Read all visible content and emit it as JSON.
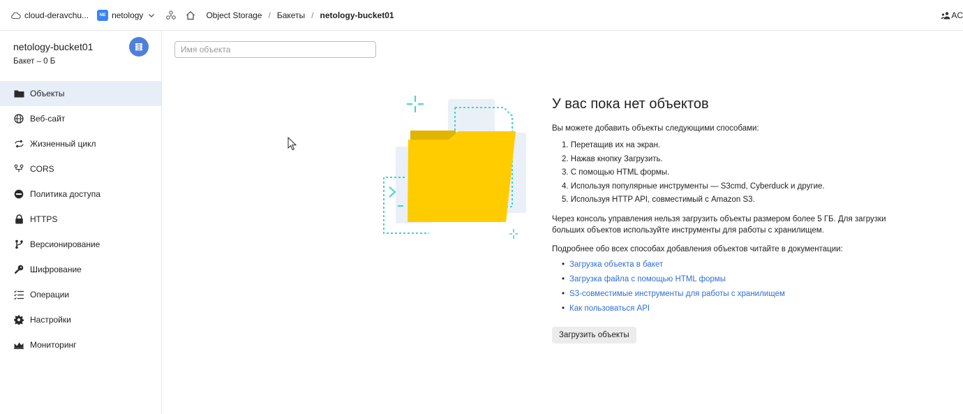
{
  "topbar": {
    "cloud_name": "cloud-deravchu...",
    "folder_badge": "NE",
    "folder_name": "netology",
    "service": "Object Storage",
    "crumb_buckets": "Бакеты",
    "crumb_current": "netology-bucket01",
    "user_initials": "AC",
    "separator": "/"
  },
  "sidebar": {
    "bucket_name": "netology-bucket01",
    "bucket_sub": "Бакет – 0 Б",
    "items": [
      {
        "label": "Объекты",
        "icon": "folder-icon"
      },
      {
        "label": "Веб-сайт",
        "icon": "globe-icon"
      },
      {
        "label": "Жизненный цикл",
        "icon": "lifecycle-icon"
      },
      {
        "label": "CORS",
        "icon": "cors-icon"
      },
      {
        "label": "Политика доступа",
        "icon": "access-policy-icon"
      },
      {
        "label": "HTTPS",
        "icon": "lock-icon"
      },
      {
        "label": "Версионирование",
        "icon": "branch-icon"
      },
      {
        "label": "Шифрование",
        "icon": "key-icon"
      },
      {
        "label": "Операции",
        "icon": "operations-list-icon"
      },
      {
        "label": "Настройки",
        "icon": "gear-icon"
      },
      {
        "label": "Мониторинг",
        "icon": "chart-icon"
      }
    ]
  },
  "main": {
    "search_placeholder": "Имя объекта",
    "title": "У вас пока нет объектов",
    "intro": "Вы можете добавить объекты следующими способами:",
    "steps": [
      "1. Перетащив их на экран.",
      "2. Нажав кнопку Загрузить.",
      "3. С помощью HTML формы.",
      "4. Используя популярные инструменты — S3cmd, Cyberduck и другие.",
      "5. Используя HTTP API, совместимый с Amazon S3."
    ],
    "limits": "Через консоль управления нельзя загрузить объекты размером более 5 ГБ. Для загрузки больших объектов используйте инструменты для работы с хранилищем.",
    "docs_intro": "Подробнее обо всех способах добавления объектов читайте в документации:",
    "links": [
      "Загрузка объекта в бакет",
      "Загрузка файла с помощью HTML формы",
      "S3-совместимые инструменты для работы с хранилищем",
      "Как пользоваться API"
    ],
    "upload_button": "Загрузить объекты"
  },
  "colors": {
    "accent": "#4e7fdb",
    "link": "#2f6fd6",
    "folder": "#ffcc00",
    "dashed": "#3ed6c4"
  }
}
